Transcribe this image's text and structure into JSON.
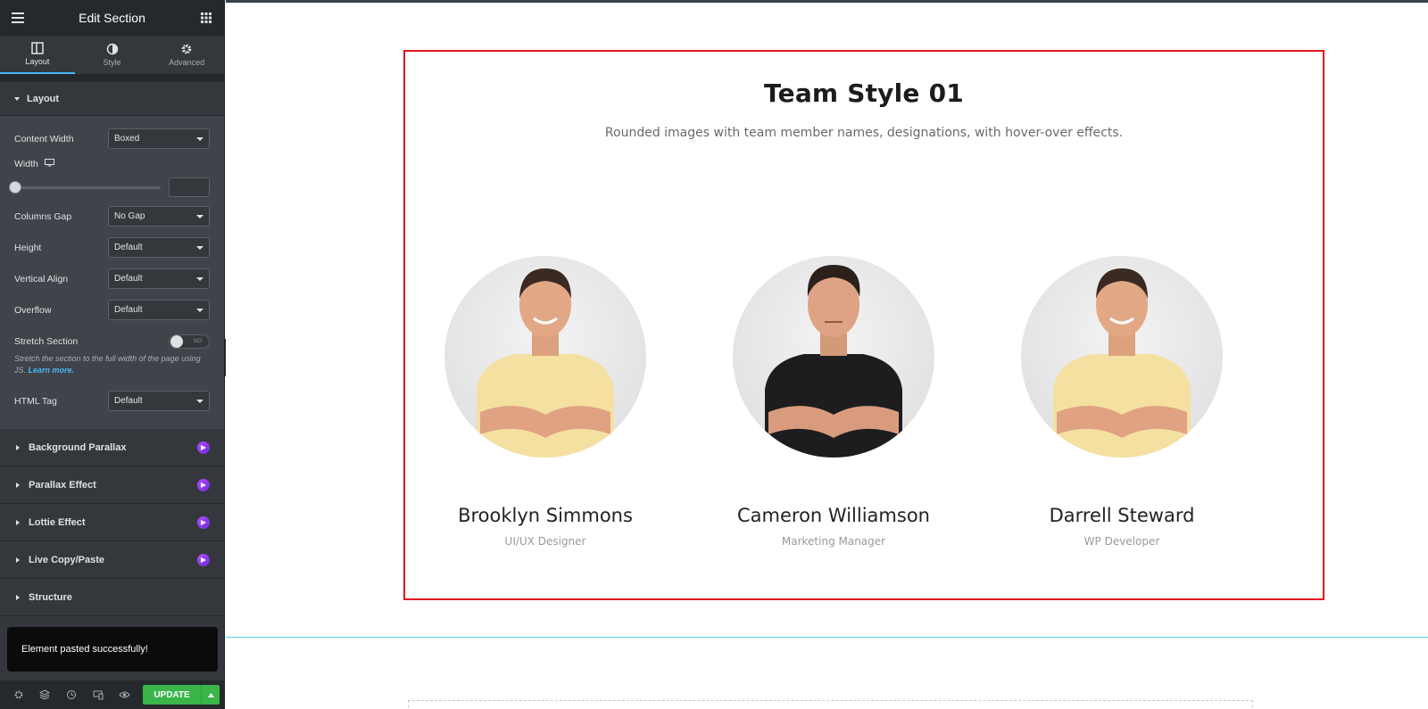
{
  "editor": {
    "title": "Edit Section",
    "tabs": [
      {
        "label": "Layout",
        "icon": "columns-icon"
      },
      {
        "label": "Style",
        "icon": "half-circle-icon"
      },
      {
        "label": "Advanced",
        "icon": "gear-icon"
      }
    ],
    "layout_section_title": "Layout",
    "controls": {
      "content_width": {
        "label": "Content Width",
        "value": "Boxed"
      },
      "width": {
        "label": "Width"
      },
      "columns_gap": {
        "label": "Columns Gap",
        "value": "No Gap"
      },
      "height": {
        "label": "Height",
        "value": "Default"
      },
      "vertical_align": {
        "label": "Vertical Align",
        "value": "Default"
      },
      "overflow": {
        "label": "Overflow",
        "value": "Default"
      },
      "stretch_section": {
        "label": "Stretch Section",
        "toggle_text": "NO",
        "help": "Stretch the section to the full width of the page using JS.",
        "help_link": "Learn more."
      },
      "html_tag": {
        "label": "HTML Tag",
        "value": "Default"
      }
    },
    "panels": [
      {
        "label": "Background Parallax",
        "pro": true
      },
      {
        "label": "Parallax Effect",
        "pro": true
      },
      {
        "label": "Lottie Effect",
        "pro": true
      },
      {
        "label": "Live Copy/Paste",
        "pro": true
      },
      {
        "label": "Structure",
        "pro": false
      }
    ],
    "toast": "Element pasted successfully!",
    "update_label": "UPDATE"
  },
  "page": {
    "heading": "Team Style 01",
    "subheading": "Rounded images with team member names, designations, with hover-over effects.",
    "members": [
      {
        "name": "Brooklyn Simmons",
        "role": "UI/UX Designer",
        "shirt": "#f4e0a0"
      },
      {
        "name": "Cameron Williamson",
        "role": "Marketing Manager",
        "shirt": "#1d1d1f"
      },
      {
        "name": "Darrell Steward",
        "role": "WP Developer",
        "shirt": "#f4e0a0"
      }
    ]
  },
  "colors": {
    "accent": "#4ab7f4",
    "update": "#39b54a",
    "section_outline": "#e0161d"
  }
}
